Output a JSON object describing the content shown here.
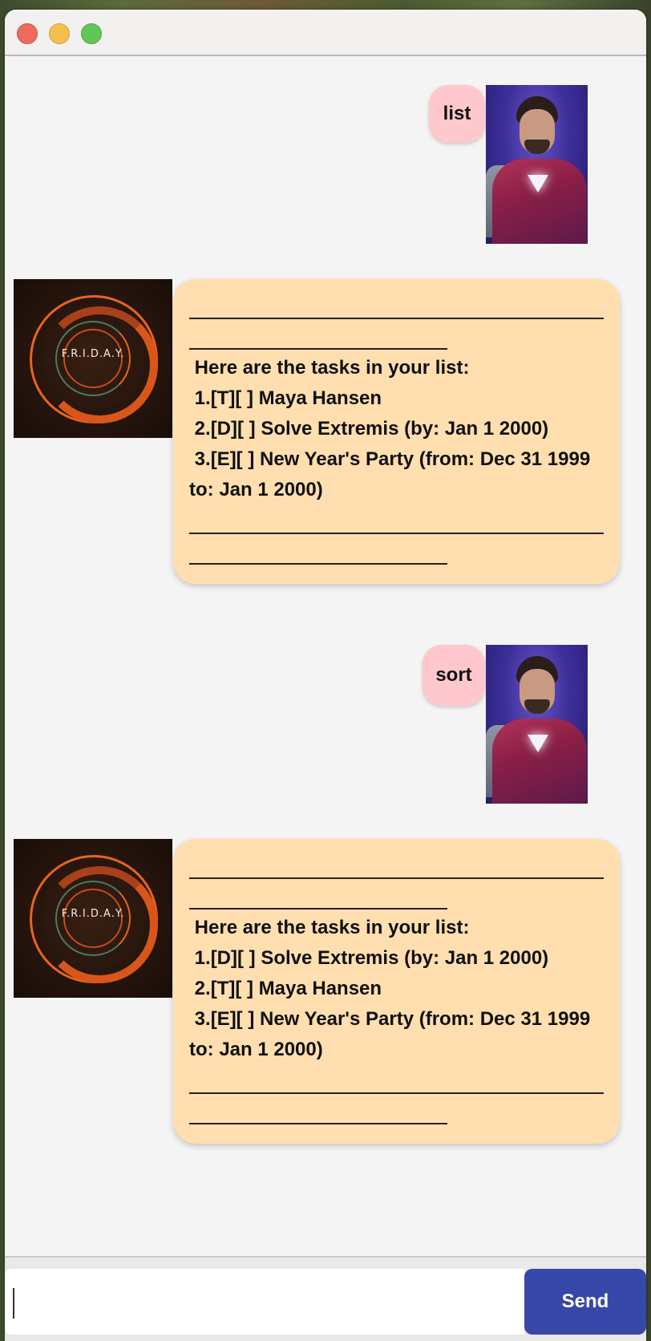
{
  "window": {
    "controls": {
      "close_color": "#ee6a5f",
      "minimize_color": "#f5bf4f",
      "maximize_color": "#62c655"
    }
  },
  "avatars": {
    "friday_label": "F.R.I.D.A.Y."
  },
  "messages": [
    {
      "sender": "user",
      "text": "list"
    },
    {
      "sender": "bot",
      "text": " Here are the tasks in your list:\n 1.[T][ ] Maya Hansen\n 2.[D][ ] Solve Extremis (by: Jan 1 2000)\n 3.[E][ ] New Year's Party (from: Dec 31 1999 to: Jan 1 2000)"
    },
    {
      "sender": "user",
      "text": "sort"
    },
    {
      "sender": "bot",
      "text": " Here are the tasks in your list:\n 1.[D][ ] Solve Extremis (by: Jan 1 2000)\n 2.[T][ ] Maya Hansen\n 3.[E][ ] New Year's Party (from: Dec 31 1999 to: Jan 1 2000)"
    }
  ],
  "input": {
    "value": "",
    "placeholder": ""
  },
  "send_button": {
    "label": "Send"
  },
  "colors": {
    "user_bubble": "#ffc8cc",
    "bot_bubble": "#ffdfb0",
    "send_button": "#3848a8",
    "chat_background": "#f4f4f4"
  }
}
